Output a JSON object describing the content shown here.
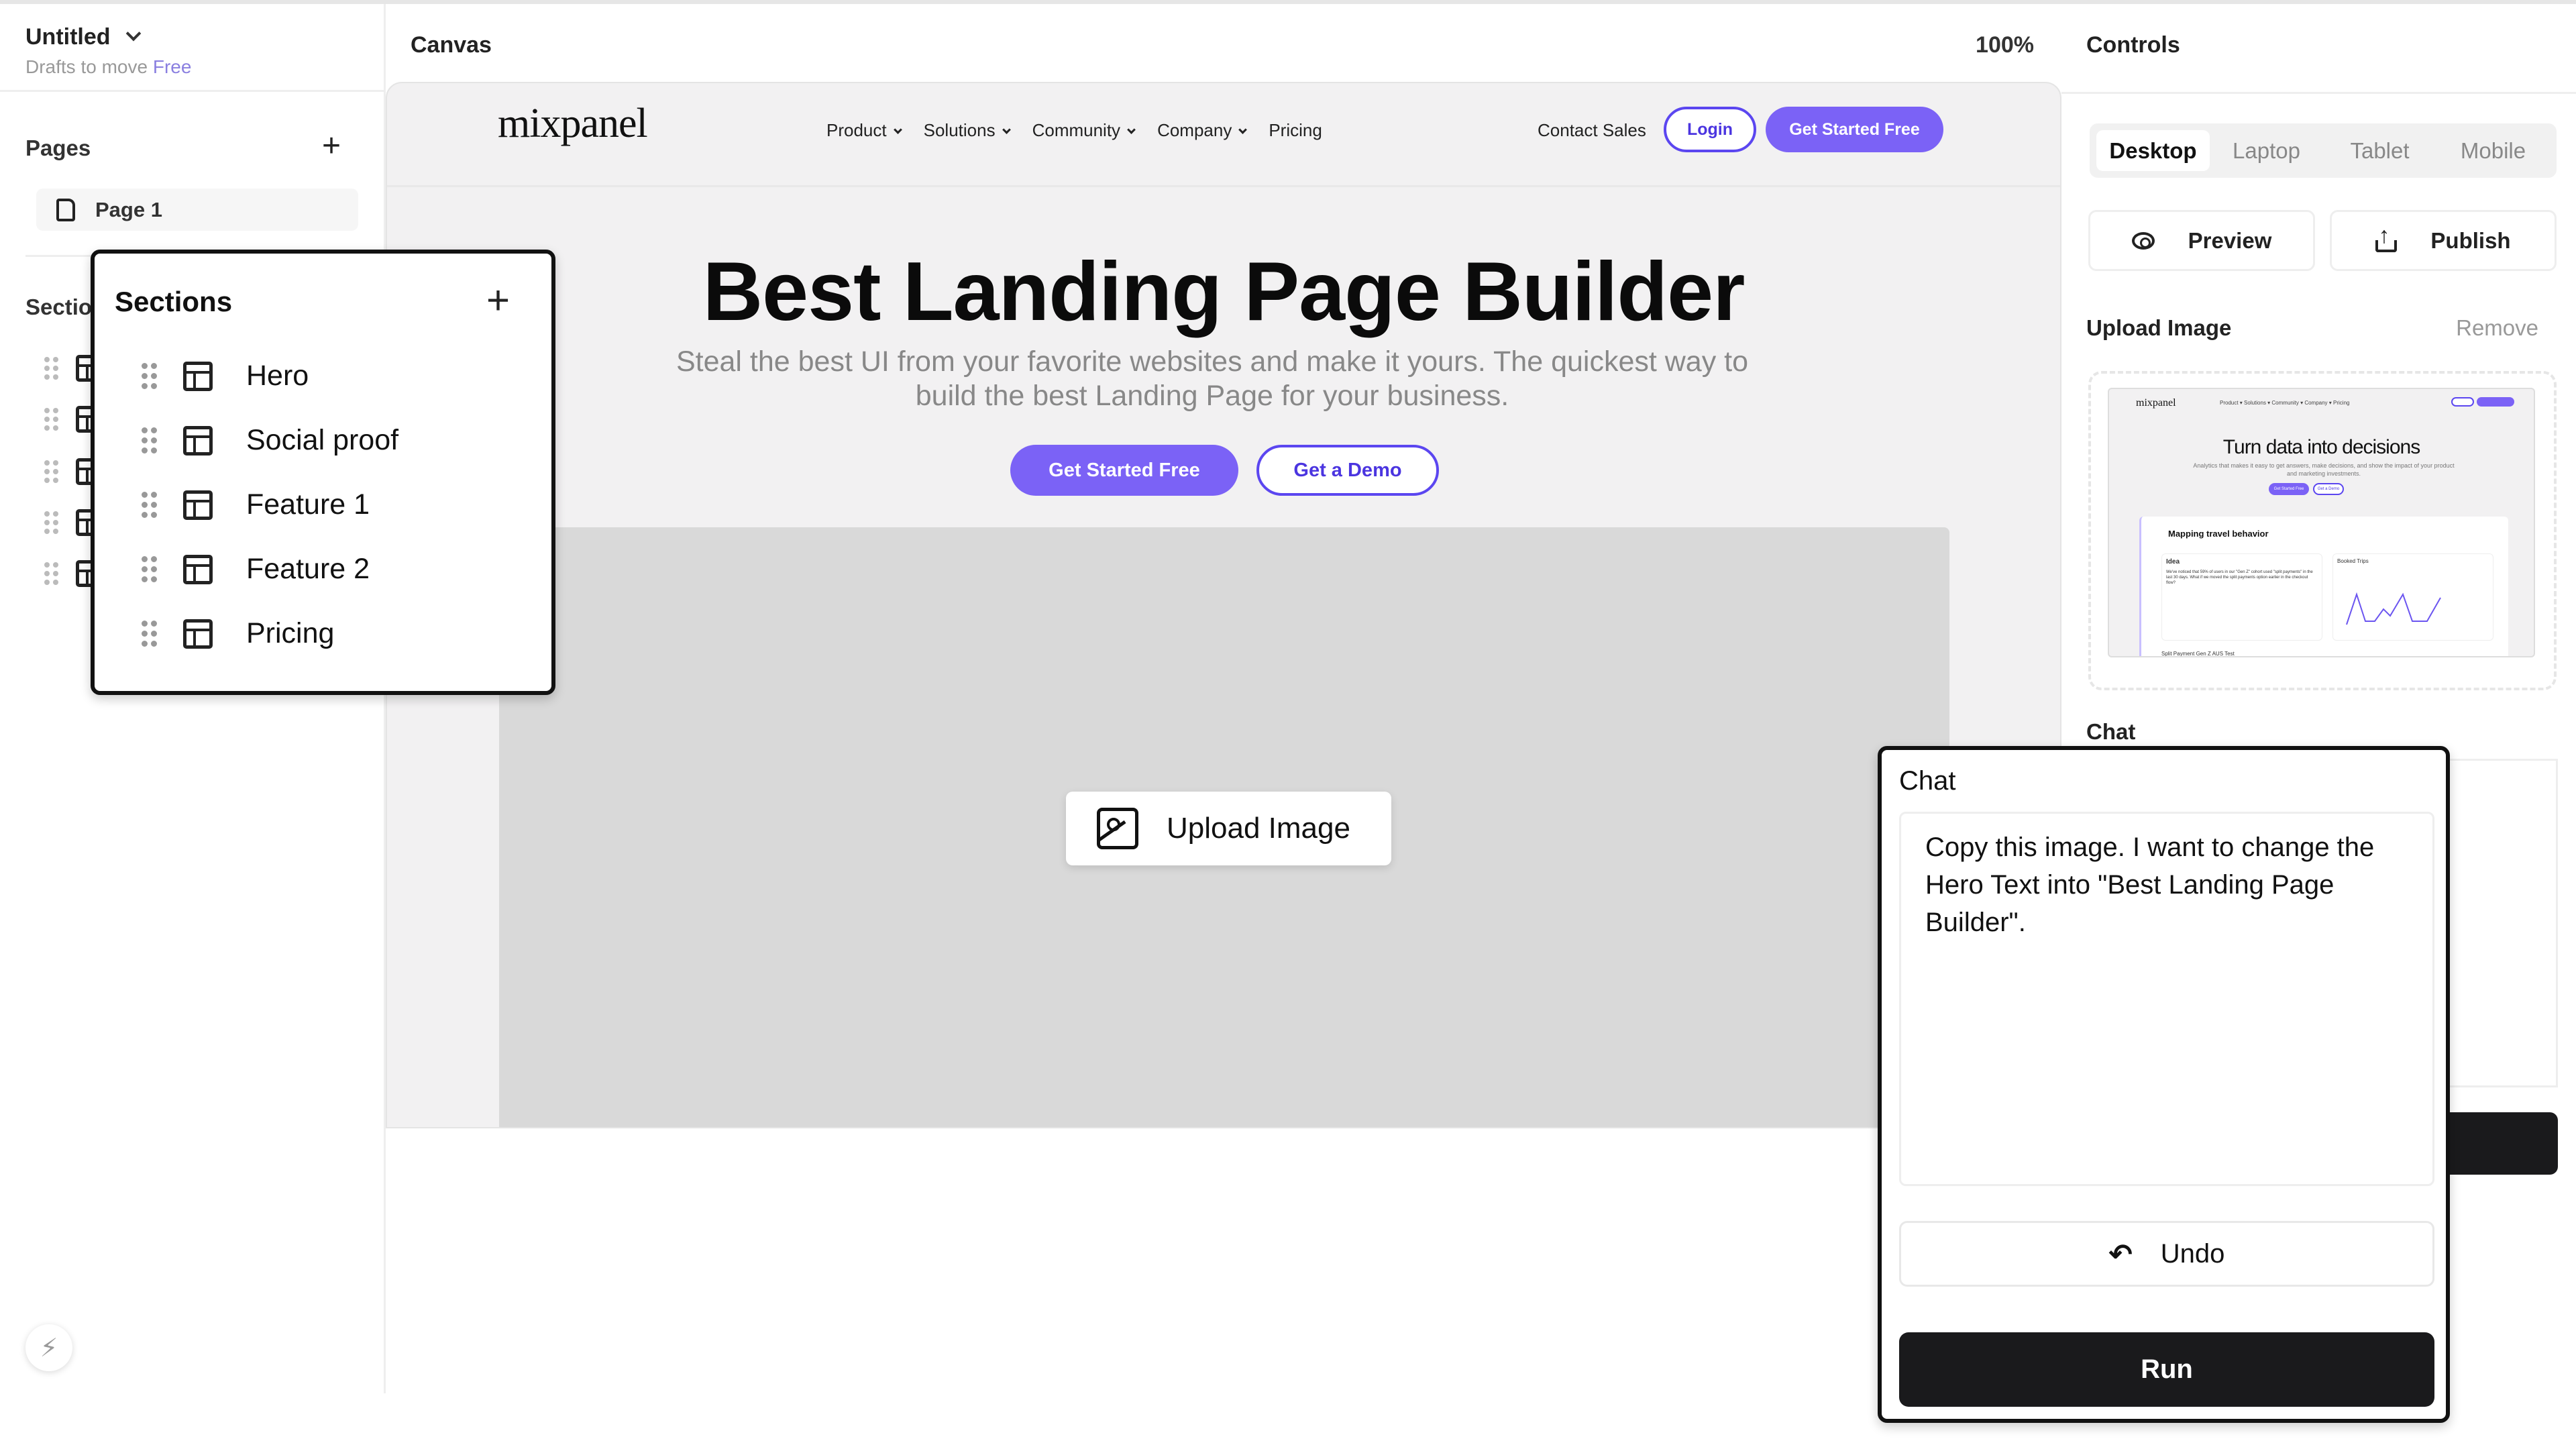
{
  "sidebar": {
    "title": "Untitled",
    "subtitle": "Drafts to move",
    "plan": "Free",
    "pages_label": "Pages",
    "pages": [
      {
        "label": "Page 1"
      }
    ],
    "sections_label_partial": "Sectio"
  },
  "canvas": {
    "title": "Canvas",
    "zoom": "100%",
    "site": {
      "logo": "mixpanel",
      "nav": [
        "Product",
        "Solutions",
        "Community",
        "Company",
        "Pricing"
      ],
      "contact": "Contact Sales",
      "login": "Login",
      "cta": "Get Started Free",
      "hero_title": "Best Landing Page Builder",
      "hero_subtitle": "Steal the best UI from your favorite websites and make it yours. The quickest way to build the best Landing Page for your business.",
      "hero_primary": "Get Started Free",
      "hero_secondary": "Get a Demo",
      "upload_label": "Upload Image"
    }
  },
  "sections_popup": {
    "title": "Sections",
    "items": [
      {
        "label": "Hero"
      },
      {
        "label": "Social proof"
      },
      {
        "label": "Feature 1"
      },
      {
        "label": "Feature 2"
      },
      {
        "label": "Pricing"
      }
    ]
  },
  "controls": {
    "title": "Controls",
    "devices": [
      "Desktop",
      "Laptop",
      "Tablet",
      "Mobile"
    ],
    "active_device": "Desktop",
    "preview": "Preview",
    "publish": "Publish",
    "upload_label": "Upload Image",
    "remove": "Remove",
    "thumbnail": {
      "logo": "mixpanel",
      "nav": "Product ▾  Solutions ▾  Community ▾  Company ▾  Pricing",
      "title": "Turn data into decisions",
      "subtitle": "Analytics that makes it easy to get answers, make decisions, and show the impact of your product and marketing investments.",
      "primary": "Get Started Free",
      "secondary": "Get a Demo",
      "dashboard_title": "Mapping travel behavior",
      "idea_title": "Idea",
      "idea_text": "We've noticed that 59% of users in our \"Gen Z\" cohort used \"split payments\" in the last 30 days. What if we moved the split payments option earlier in the checkout flow?",
      "chart_title": "Booked Trips",
      "card_title": "Split Payment Gen Z AUS Test"
    },
    "chat_label": "Chat"
  },
  "chat": {
    "title": "Chat",
    "message": "Copy this image. I want to change the Hero Text into \"Best Landing Page Builder\".",
    "undo": "Undo",
    "run": "Run"
  },
  "colors": {
    "accent": "#7b62f6",
    "accent_dark": "#5b46f0",
    "run": "#1a1a1c"
  }
}
